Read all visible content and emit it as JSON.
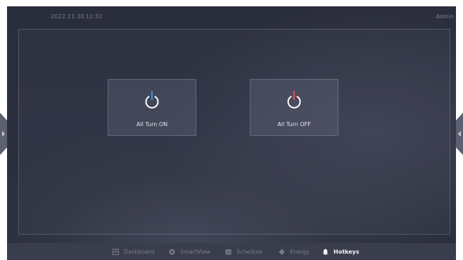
{
  "topbar": {
    "date": "2022.11.30",
    "time": "11:32",
    "user": "Admin"
  },
  "hotkeys": [
    {
      "label": "All Turn ON",
      "icon": "power-icon",
      "accent": "#3a8fd8"
    },
    {
      "label": "All Turn OFF",
      "icon": "power-icon",
      "accent": "#d8505a"
    }
  ],
  "nav": {
    "items": [
      {
        "label": "Dashboard",
        "icon": "dashboard-icon",
        "active": false
      },
      {
        "label": "SmartView",
        "icon": "smartview-icon",
        "active": false
      },
      {
        "label": "Schedule",
        "icon": "schedule-icon",
        "active": false
      },
      {
        "label": "Energy",
        "icon": "energy-icon",
        "active": false
      },
      {
        "label": "Hotkeys",
        "icon": "hotkeys-icon",
        "active": true
      }
    ]
  },
  "colors": {
    "background": "#2b2e3d",
    "navbar": "#3a3d4c",
    "text_muted": "#777b8c",
    "text_active": "#f2f3f7"
  }
}
